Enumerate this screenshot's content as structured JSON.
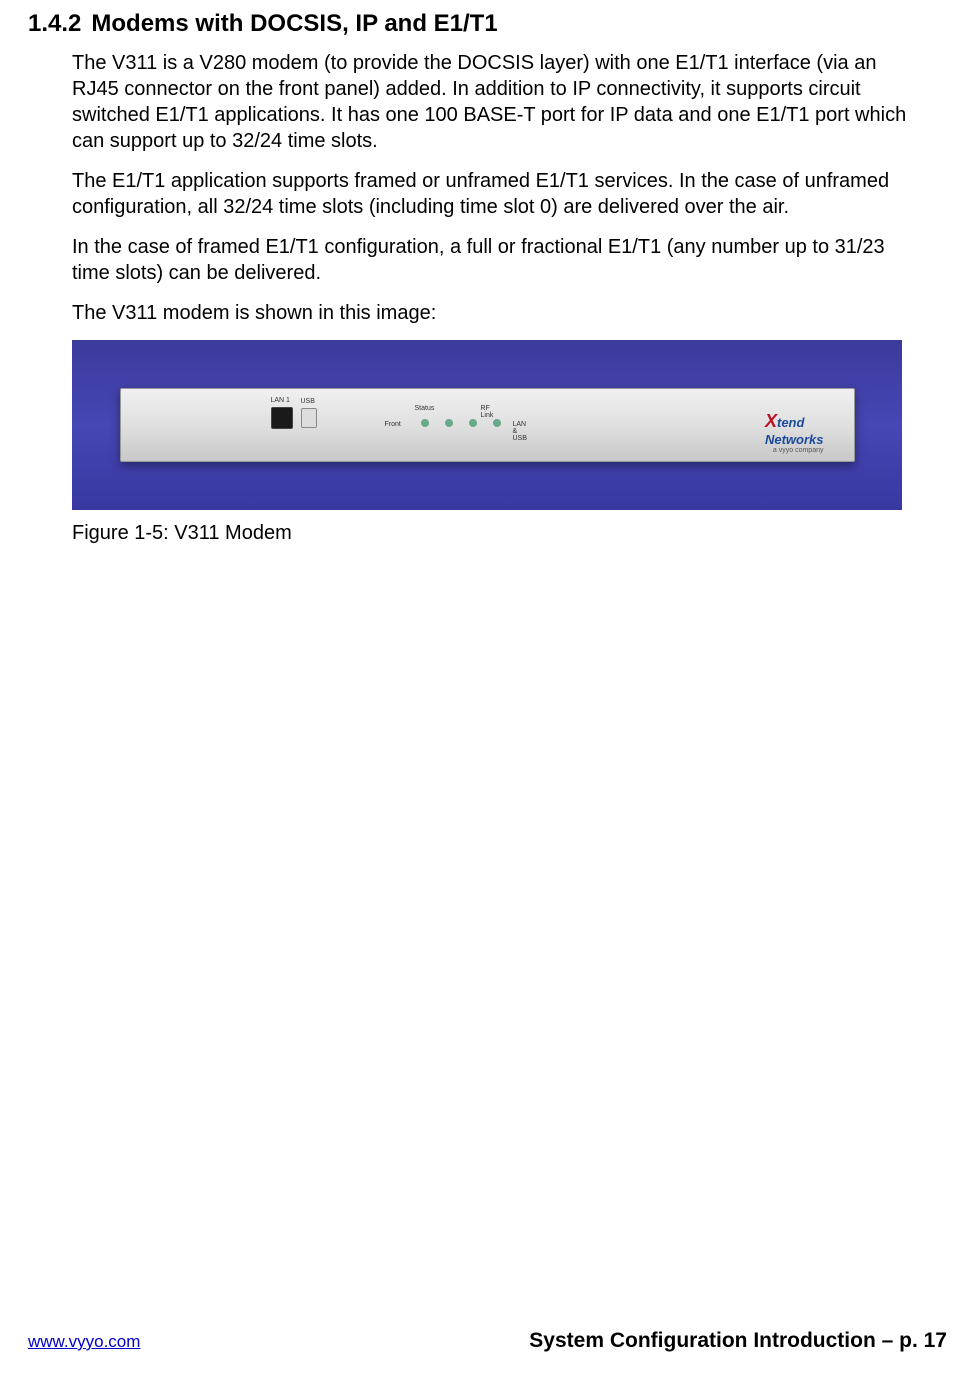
{
  "heading": {
    "number": "1.4.2",
    "title": "Modems with DOCSIS, IP and E1/T1"
  },
  "paragraphs": [
    "The V311 is a V280 modem (to provide the DOCSIS layer) with one E1/T1 interface (via an RJ45 connector on the front panel) added.  In addition to IP connectivity, it supports circuit switched E1/T1 applications. It has one 100 BASE-T port for IP data and one E1/T1 port which can support up to 32/24 time slots.",
    "The E1/T1 application supports framed or unframed E1/T1 services. In the case of unframed configuration, all 32/24 time slots (including time slot 0) are delivered over the air.",
    "In the case of framed E1/T1 configuration, a full or fractional E1/T1 (any number up to 31/23 time slots) can be delivered.",
    "The V311 modem is shown in this image:"
  ],
  "figure": {
    "caption": "Figure 1-5:  V311 Modem",
    "device_labels": {
      "lan": "LAN 1",
      "usb": "USB",
      "status": "Status",
      "front": "Front",
      "rflink": "RF Link",
      "lanusb": "LAN & USB"
    },
    "logo": {
      "x": "X",
      "tend": "tend",
      "networks": "Networks",
      "subtitle": "a vyyo company"
    }
  },
  "footer": {
    "link": "www.vyyo.com",
    "right": "System Configuration Introduction – p. 17"
  }
}
